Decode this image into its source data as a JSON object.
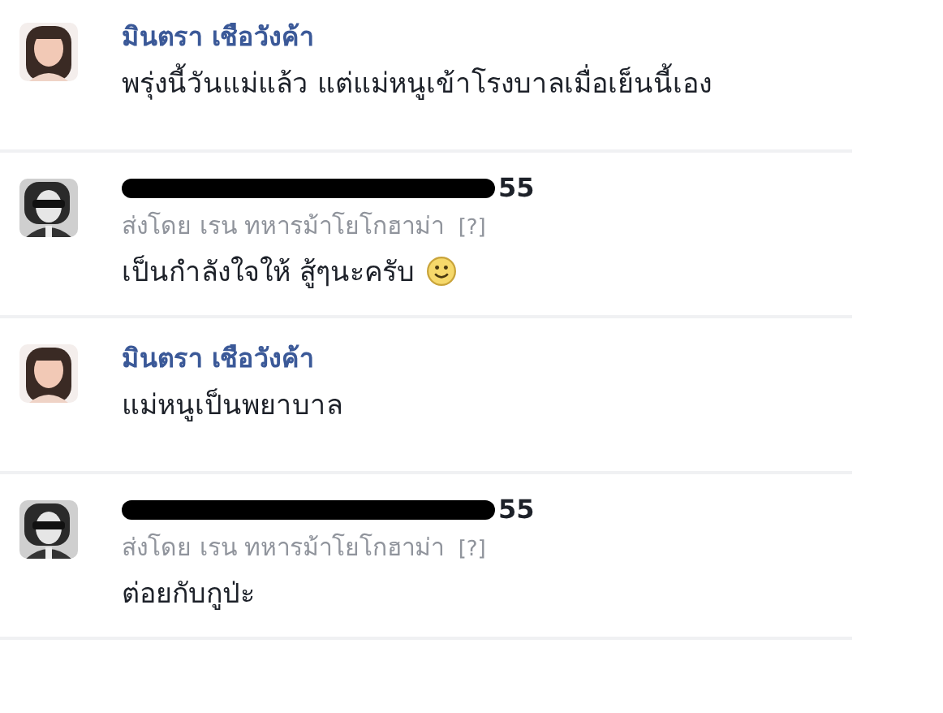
{
  "comments": [
    {
      "kind": "user",
      "author": "มินตรา เชือวังค้า",
      "text": "พรุ่งนี้วันแม่แล้ว แต่แม่หนูเข้าโรงบาลเมื่อเย็นนี้เอง"
    },
    {
      "kind": "page",
      "author": "55",
      "posted_by": "ส่งโดย เรน ทหารม้าโยโกฮาม่า",
      "help": "[?]",
      "text": "เป็นกำลังใจให้ สู้ๆนะครับ",
      "smiley": true
    },
    {
      "kind": "user",
      "author": "มินตรา เชือวังค้า",
      "text": "แม่หนูเป็นพยาบาล"
    },
    {
      "kind": "page",
      "author": "55",
      "posted_by": "ส่งโดย เรน ทหารม้าโยโกฮาม่า",
      "help": "[?]",
      "text": "ต่อยกับกูป่ะ"
    }
  ]
}
